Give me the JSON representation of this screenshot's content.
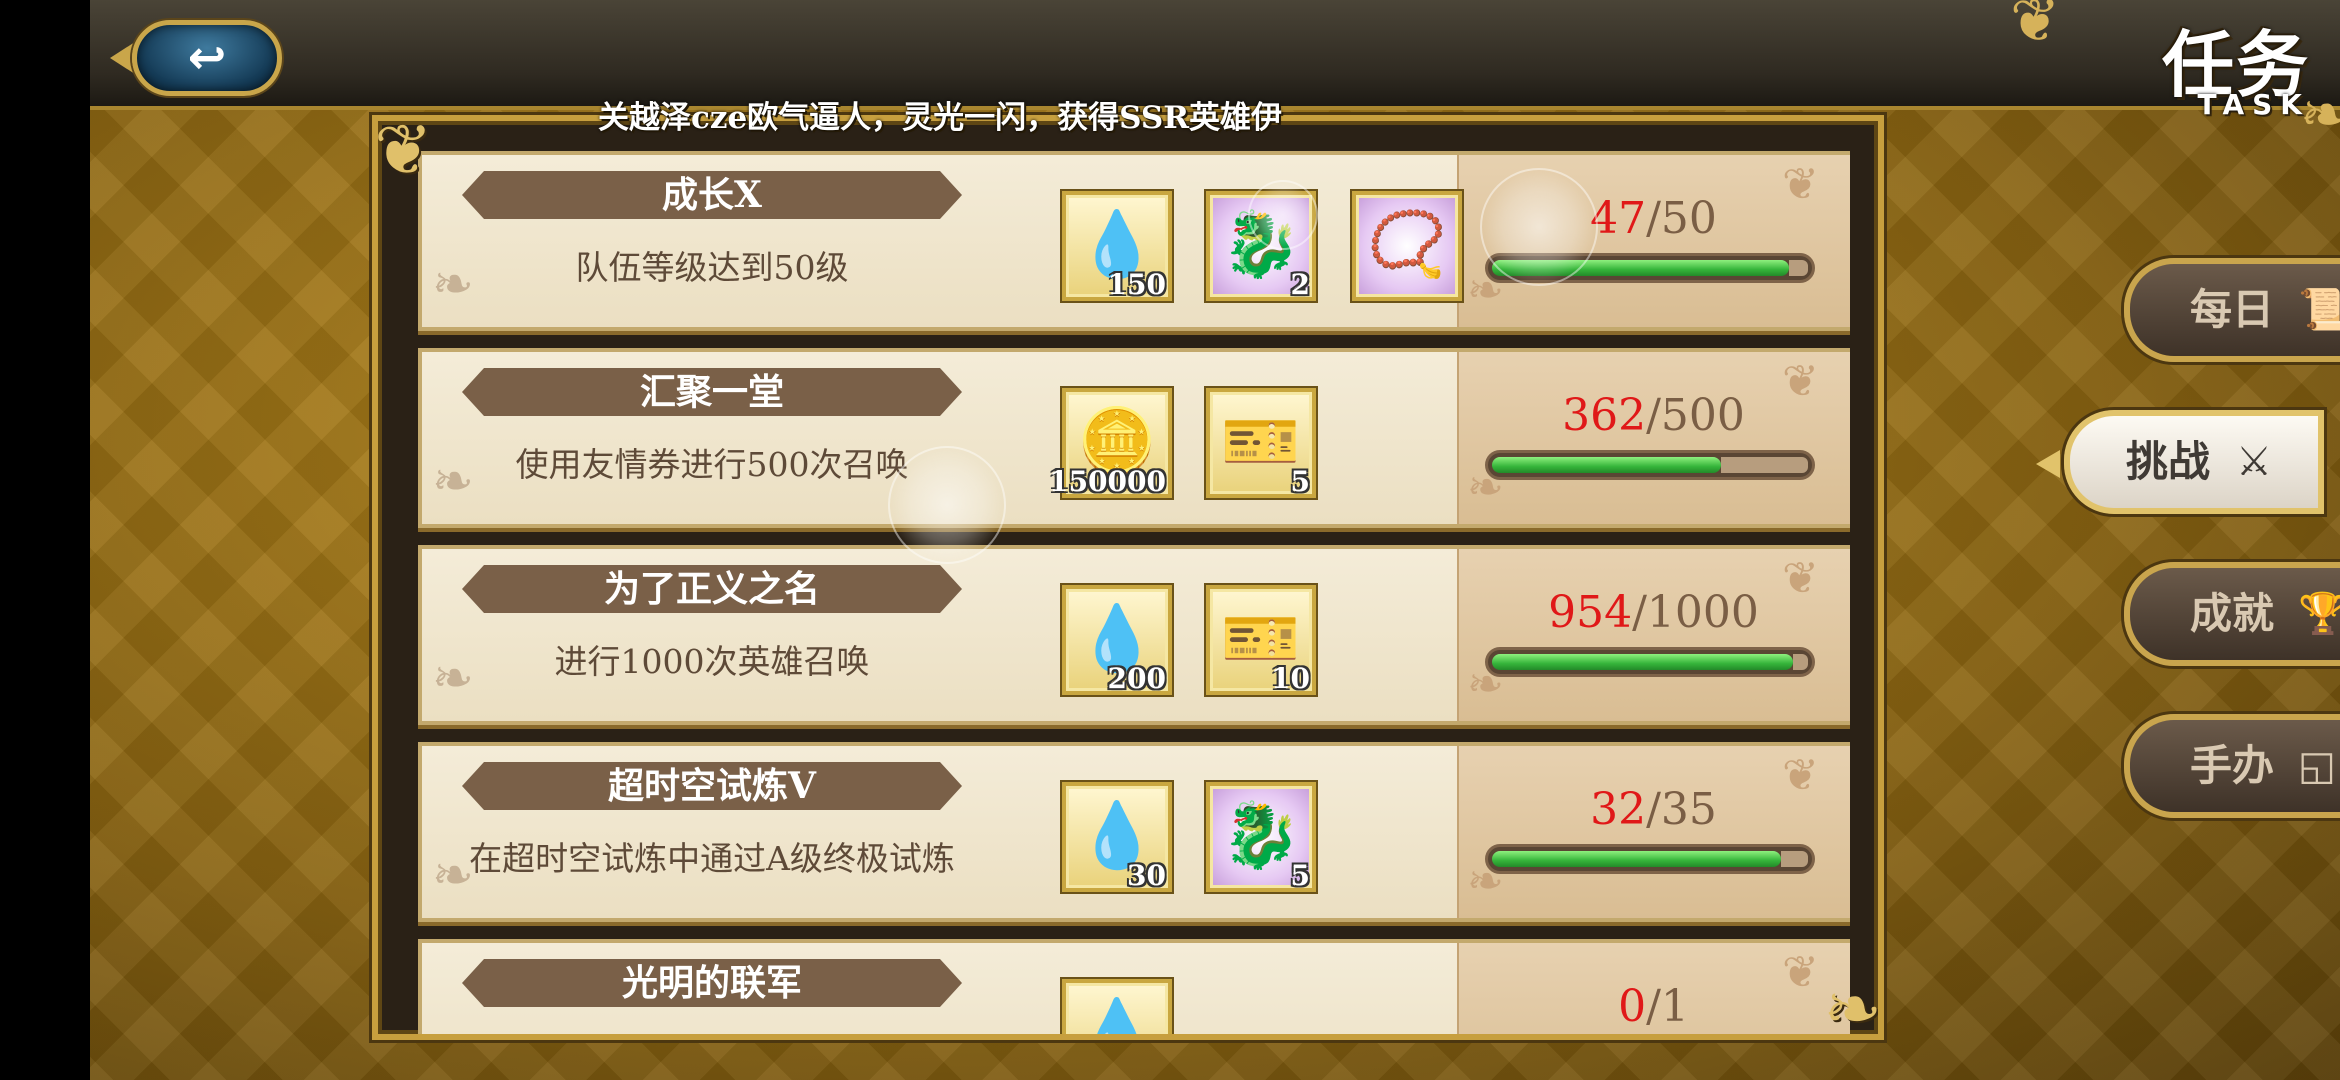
{
  "header": {
    "title": "任务",
    "subtitle": "TASK",
    "back_icon": "return-arrow-icon"
  },
  "marquee": "关越泽cze欧气逼人，灵光一闪，获得SSR英雄伊",
  "tabs": [
    {
      "label": "每日",
      "icon": "scroll-icon",
      "glyph": "📜",
      "active": false
    },
    {
      "label": "挑战",
      "icon": "crossed-swords-icon",
      "glyph": "⚔",
      "active": true
    },
    {
      "label": "成就",
      "icon": "trophy-icon",
      "glyph": "🏆",
      "active": false
    },
    {
      "label": "手办",
      "icon": "figure-box-icon",
      "glyph": "◱",
      "active": false
    }
  ],
  "colors": {
    "progress_current": "#e01818",
    "progress_fill": "#35b43a",
    "banner": "#7a6048",
    "gold_border": "#c79f3e"
  },
  "tasks": [
    {
      "name": "成长X",
      "description": "队伍等级达到50级",
      "current": "47",
      "total": "/50",
      "progress": 0.94,
      "rewards": [
        {
          "icon": "rainbow-crystal-icon",
          "glyph": "💧",
          "count": "150"
        },
        {
          "icon": "blue-dragon-shard-icon",
          "glyph": "🐉",
          "count": "2",
          "ssr": true
        },
        {
          "icon": "golden-pendant-icon",
          "glyph": "📿",
          "count": "",
          "ssr": true
        }
      ]
    },
    {
      "name": "汇聚一堂",
      "description": "使用友情券进行500次召唤",
      "current": "362",
      "total": "/500",
      "progress": 0.724,
      "rewards": [
        {
          "icon": "gold-coin-icon",
          "glyph": "🪙",
          "count": "150000"
        },
        {
          "icon": "summon-ticket-icon",
          "glyph": "🎫",
          "count": "5"
        }
      ]
    },
    {
      "name": "为了正义之名",
      "description": "进行1000次英雄召唤",
      "current": "954",
      "total": "/1000",
      "progress": 0.954,
      "rewards": [
        {
          "icon": "rainbow-crystal-icon",
          "glyph": "💧",
          "count": "200"
        },
        {
          "icon": "summon-ticket-icon",
          "glyph": "🎫",
          "count": "10"
        }
      ]
    },
    {
      "name": "超时空试炼V",
      "description": "在超时空试炼中通过A级终极试炼",
      "current": "32",
      "total": "/35",
      "progress": 0.914,
      "rewards": [
        {
          "icon": "rainbow-crystal-icon",
          "glyph": "💧",
          "count": "30"
        },
        {
          "icon": "blue-dragon-shard-icon",
          "glyph": "🐉",
          "count": "5",
          "ssr": true
        }
      ]
    },
    {
      "name": "光明的联军",
      "description": "",
      "current": "0",
      "total": "/1",
      "progress": 0,
      "rewards": [
        {
          "icon": "rainbow-crystal-icon",
          "glyph": "💧",
          "count": ""
        }
      ]
    }
  ]
}
